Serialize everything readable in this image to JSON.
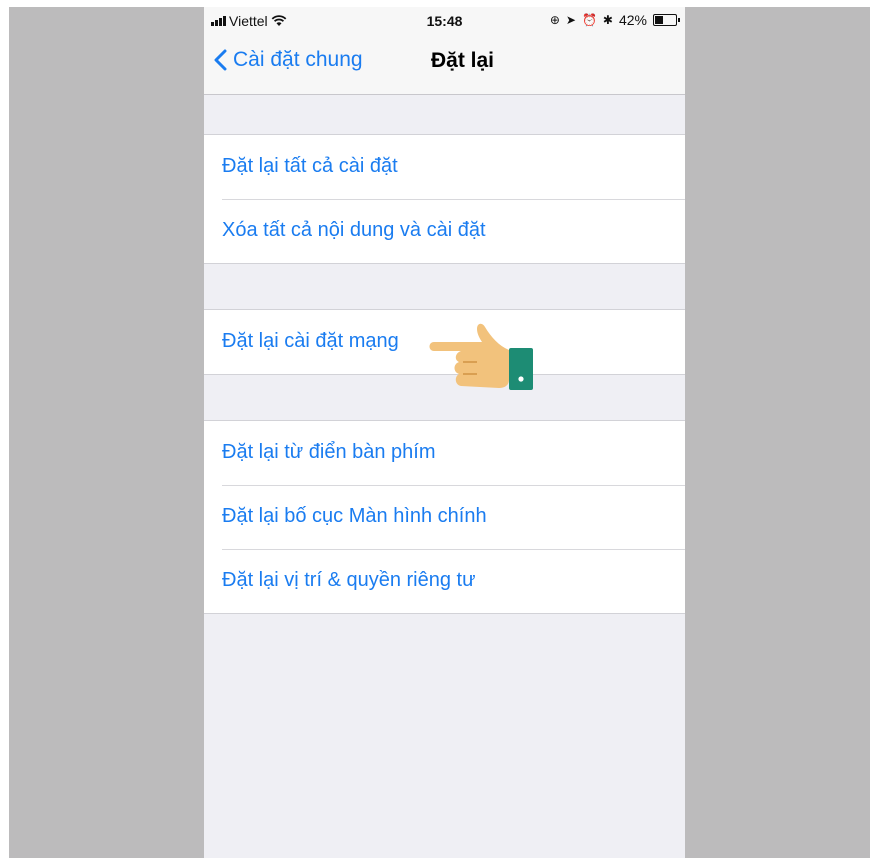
{
  "status_bar": {
    "carrier": "Viettel",
    "time": "15:48",
    "battery": "42%",
    "battery_level": 0.42
  },
  "nav": {
    "back_label": "Cài đặt chung",
    "title": "Đặt lại"
  },
  "groups": [
    [
      "Đặt lại tất cả cài đặt",
      "Xóa tất cả nội dung và cài đặt"
    ],
    [
      "Đặt lại cài đặt mạng"
    ],
    [
      "Đặt lại từ điển bàn phím",
      "Đặt lại bố cục Màn hình chính",
      "Đặt lại vị trí & quyền riêng tư"
    ]
  ],
  "colors": {
    "accent": "#1a7cf0",
    "grouped_background": "#efeff4",
    "backdrop": "#bcbbbc",
    "pointer_skin": "#f2c27c",
    "pointer_cuff": "#1d8c74"
  },
  "icons": {
    "pointer": "pointing-hand-icon"
  }
}
